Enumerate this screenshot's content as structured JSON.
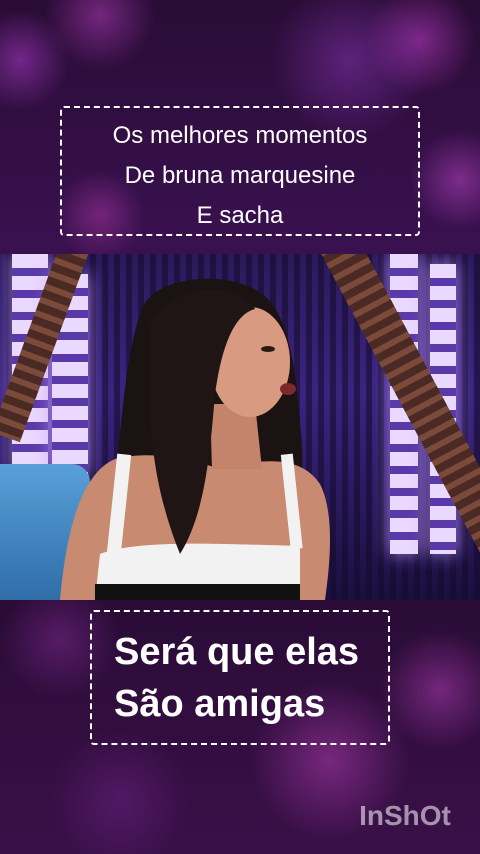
{
  "top_caption": {
    "lines": [
      "Os melhores  momentos",
      "De bruna marquesine",
      "E sacha"
    ]
  },
  "bottom_caption": {
    "lines": [
      "Será que elas",
      "São amigas"
    ]
  },
  "watermark": {
    "text": "InShOt"
  },
  "video": {
    "icon": "talk-show-video-frame"
  },
  "colors": {
    "background": "#2a0c36",
    "caption_text": "#ffffff",
    "caption_border": "#ffffff",
    "accent_purple": "#a03cc8"
  }
}
